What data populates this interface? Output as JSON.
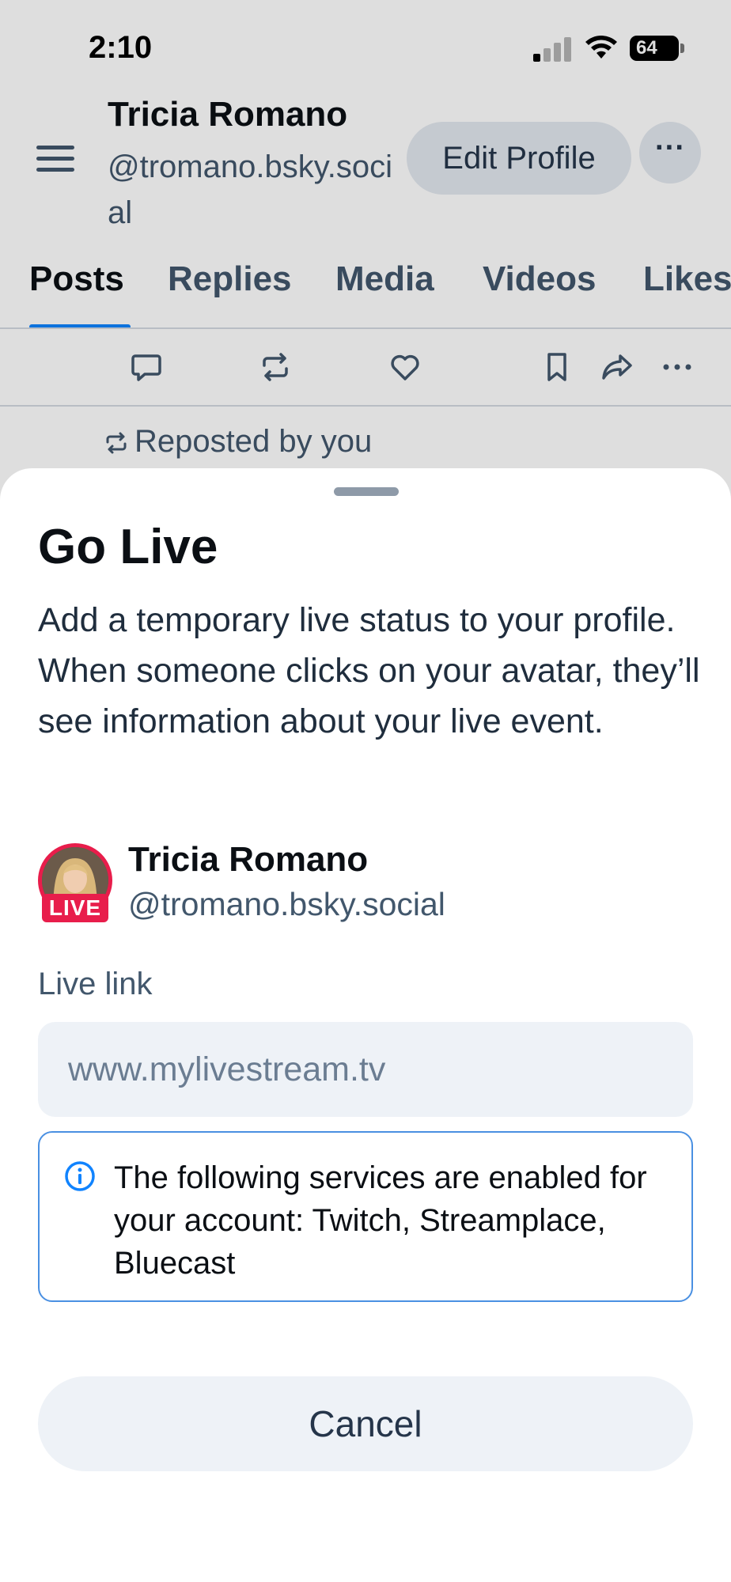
{
  "status_bar": {
    "time": "2:10",
    "battery": "64",
    "icons": [
      "signal-icon",
      "wifi-icon",
      "battery-icon"
    ]
  },
  "profile_header": {
    "name": "Tricia Romano",
    "handle": "@tromano.bsky.social",
    "edit_profile_label": "Edit Profile",
    "more_label": "···"
  },
  "tabs": [
    {
      "label": "Posts",
      "active": true
    },
    {
      "label": "Replies",
      "active": false
    },
    {
      "label": "Media",
      "active": false
    },
    {
      "label": "Videos",
      "active": false
    },
    {
      "label": "Likes",
      "active": false
    }
  ],
  "post": {
    "action_icons": [
      "reply-icon",
      "repost-icon",
      "like-icon",
      "bookmark-icon",
      "share-icon",
      "more-icon"
    ],
    "repost_text": "Reposted by you"
  },
  "sheet": {
    "title": "Go Live",
    "description": "Add a temporary live status to your profile. When someone clicks on your avatar, they’ll see information about your live event.",
    "user": {
      "name": "Tricia Romano",
      "handle": "@tromano.bsky.social",
      "badge": "LIVE"
    },
    "live_link_label": "Live link",
    "live_link_placeholder": "www.mylivestream.tv",
    "live_link_value": "",
    "info_text": "The following services are enabled for your account: Twitch, Streamplace, Bluecast",
    "cancel_label": "Cancel"
  },
  "colors": {
    "accent": "#1083fe",
    "live_red": "#e81d4b",
    "info_border": "#4a90e2"
  }
}
